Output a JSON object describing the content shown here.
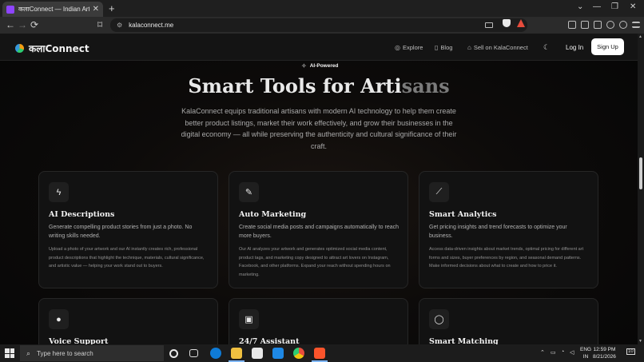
{
  "browser": {
    "tab_title": "कलाConnect — Indian Art Marke",
    "tab_close": "✕",
    "new_tab": "+",
    "url": "kalaconnect.me",
    "window_min": "—",
    "window_restore": "❐",
    "window_close": "✕",
    "tab_list": "⌄",
    "back": "←",
    "forward": "→",
    "reload": "⟳",
    "bookmark": "⌑"
  },
  "site": {
    "logo_text": "कलाConnect",
    "nav": [
      {
        "icon": "compass-icon",
        "glyph": "◎",
        "label": "Explore"
      },
      {
        "icon": "book-icon",
        "glyph": "▯",
        "label": "Blog"
      },
      {
        "icon": "store-icon",
        "glyph": "⌂",
        "label": "Sell on KalaConnect"
      }
    ],
    "theme_toggle_glyph": "☾",
    "login_label": "Log In",
    "signup_label": "Sign Up"
  },
  "hero": {
    "badge": "AI-Powered",
    "title_main": "Smart Tools for Arti",
    "title_fade": "sans",
    "description": "KalaConnect equips traditional artisans with modern AI technology to help them create better product listings, market their work effectively, and grow their businesses in the digital economy — all while preserving the authenticity and cultural significance of their craft."
  },
  "cards": [
    {
      "icon": "lightning-icon",
      "glyph": "ϟ",
      "title": "AI Descriptions",
      "subtitle": "Generate compelling product stories from just a photo. No writing skills needed.",
      "body": "Upload a photo of your artwork and our AI instantly creates rich, professional product descriptions that highlight the technique, materials, cultural significance, and artistic value — helping your work stand out to buyers."
    },
    {
      "icon": "pencil-icon",
      "glyph": "✎",
      "title": "Auto Marketing",
      "subtitle": "Create social media posts and campaigns automatically to reach more buyers.",
      "body": "Our AI analyzes your artwork and generates optimized social media content, product tags, and marketing copy designed to attract art lovers on Instagram, Facebook, and other platforms. Expand your reach without spending hours on marketing."
    },
    {
      "icon": "chart-line-icon",
      "glyph": "⟋",
      "title": "Smart Analytics",
      "subtitle": "Get pricing insights and trend forecasts to optimize your business.",
      "body": "Access data-driven insights about market trends, optimal pricing for different art forms and sizes, buyer preferences by region, and seasonal demand patterns. Make informed decisions about what to create and how to price it."
    },
    {
      "icon": "microphone-icon",
      "glyph": "🎙",
      "title": "Voice Support",
      "subtitle": "",
      "body": ""
    },
    {
      "icon": "robot-icon",
      "glyph": "▣",
      "title": "24/7 Assistant",
      "subtitle": "",
      "body": ""
    },
    {
      "icon": "chat-bubble-icon",
      "glyph": "◯",
      "title": "Smart Matching",
      "subtitle": "",
      "body": ""
    }
  ],
  "taskbar": {
    "search_placeholder": "Type here to search",
    "lang_top": "ENG",
    "lang_bottom": "IN",
    "time": "12:59 PM",
    "date": "8/21/2026",
    "notification_count": "10"
  }
}
